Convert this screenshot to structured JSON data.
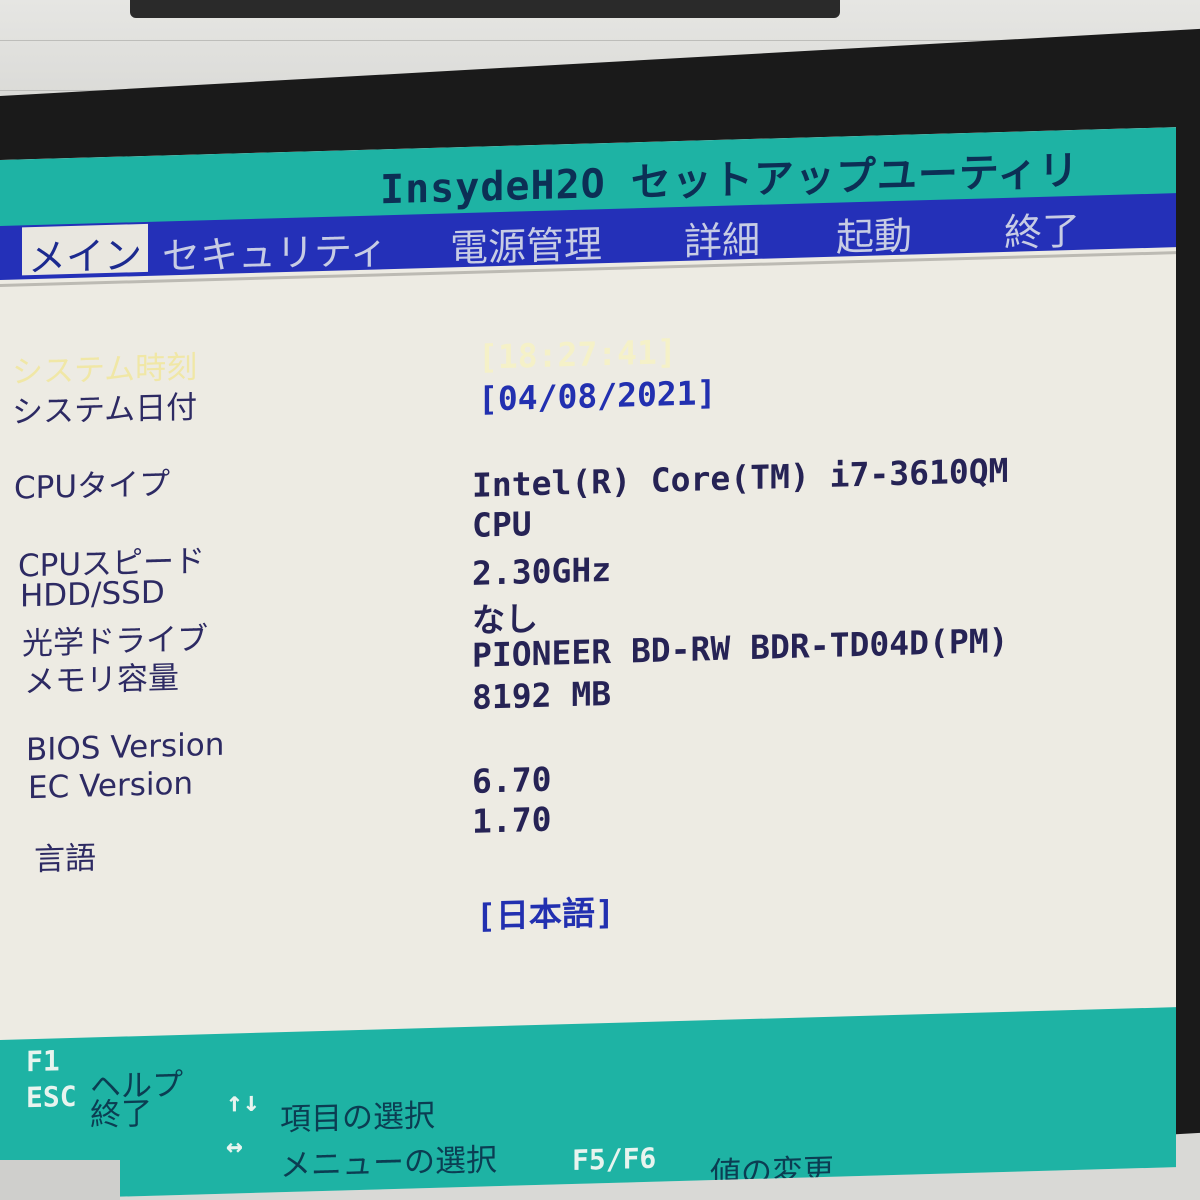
{
  "bios": {
    "title": "InsydeH2O セットアップユーティリ",
    "menu": [
      {
        "label": "メイン",
        "active": true
      },
      {
        "label": "セキュリティ",
        "active": false
      },
      {
        "label": "電源管理",
        "active": false
      },
      {
        "label": "詳細",
        "active": false
      },
      {
        "label": "起動",
        "active": false
      },
      {
        "label": "終了",
        "active": false
      }
    ],
    "fields": {
      "system_time": {
        "label": "システム時刻",
        "value": "[18:27:41]"
      },
      "system_date": {
        "label": "システム日付",
        "value": "[04/08/2021]"
      },
      "cpu_type": {
        "label": "CPUタイプ",
        "value_line1": "Intel(R) Core(TM) i7-3610QM",
        "value_line2": "CPU"
      },
      "cpu_speed": {
        "label": "CPUスピード",
        "value": "2.30GHz"
      },
      "hdd_ssd": {
        "label": "HDD/SSD",
        "value": "なし"
      },
      "optical_drive": {
        "label": "光学ドライブ",
        "value": "PIONEER BD-RW  BDR-TD04D(PM)"
      },
      "memory": {
        "label": "メモリ容量",
        "value": "8192 MB"
      },
      "bios_version": {
        "label": "BIOS Version",
        "value": "6.70"
      },
      "ec_version": {
        "label": "EC Version",
        "value": "1.70"
      },
      "language": {
        "label": "言語",
        "value": "[日本語]"
      }
    },
    "footer": {
      "f1_key": "F1",
      "f1_hint": "ヘルプ",
      "esc_key": "ESC",
      "esc_hint": "終了",
      "updown_key": "↑↓",
      "updown_hint": "項目の選択",
      "leftright_key": "↔",
      "leftright_hint": "メニューの選択",
      "f5f6_key": "F5/F6",
      "f5f6_hint": "値の変更"
    },
    "colors": {
      "title_bar": "#1eb3a4",
      "menu_bar": "#2430b8",
      "screen_bg": "#edebe3",
      "editable_value": "#2230b0"
    }
  }
}
